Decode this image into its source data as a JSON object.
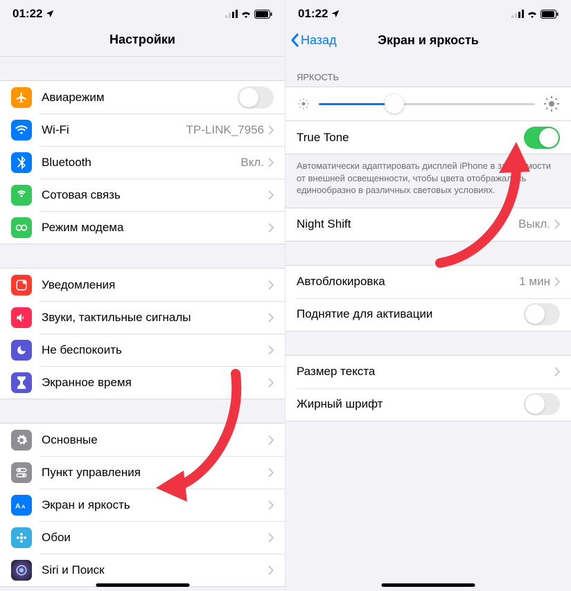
{
  "status": {
    "time": "01:22"
  },
  "left": {
    "title": "Настройки",
    "rows1": [
      {
        "icon": "airplane",
        "bg": "#ff9500",
        "label": "Авиарежим",
        "toggle": "off"
      },
      {
        "icon": "wifi",
        "bg": "#007aff",
        "label": "Wi-Fi",
        "value": "TP-LINK_7956"
      },
      {
        "icon": "bluetooth",
        "bg": "#007aff",
        "label": "Bluetooth",
        "value": "Вкл."
      },
      {
        "icon": "cellular",
        "bg": "#34c759",
        "label": "Сотовая связь",
        "value": ""
      },
      {
        "icon": "hotspot",
        "bg": "#34c759",
        "label": "Режим модема",
        "value": ""
      }
    ],
    "rows2": [
      {
        "icon": "notify",
        "bg": "#ff3b30",
        "label": "Уведомления"
      },
      {
        "icon": "sounds",
        "bg": "#ff2d55",
        "label": "Звуки, тактильные сигналы"
      },
      {
        "icon": "dnd",
        "bg": "#5856d6",
        "label": "Не беспокоить"
      },
      {
        "icon": "screentime",
        "bg": "#5856d6",
        "label": "Экранное время"
      }
    ],
    "rows3": [
      {
        "icon": "general",
        "bg": "#8e8e93",
        "label": "Основные"
      },
      {
        "icon": "control",
        "bg": "#8e8e93",
        "label": "Пункт управления"
      },
      {
        "icon": "display",
        "bg": "#007aff",
        "label": "Экран и яркость"
      },
      {
        "icon": "wallpaper",
        "bg": "#37aee2",
        "label": "Обои"
      },
      {
        "icon": "siri",
        "bg": "#1c1c1e",
        "label": "Siri и Поиск"
      }
    ]
  },
  "right": {
    "back": "Назад",
    "title": "Экран и яркость",
    "sectionBrightness": "ЯРКОСТЬ",
    "trueTone": "True Tone",
    "trueToneNote": "Автоматически адаптировать дисплей iPhone в зависимости от внешней освещенности, чтобы цвета отображались единообразно в различных световых условиях.",
    "nightShift": {
      "label": "Night Shift",
      "value": "Выкл."
    },
    "autoLock": {
      "label": "Автоблокировка",
      "value": "1 мин"
    },
    "raiseToWake": "Поднятие для активации",
    "textSize": "Размер текста",
    "boldText": "Жирный шрифт"
  }
}
